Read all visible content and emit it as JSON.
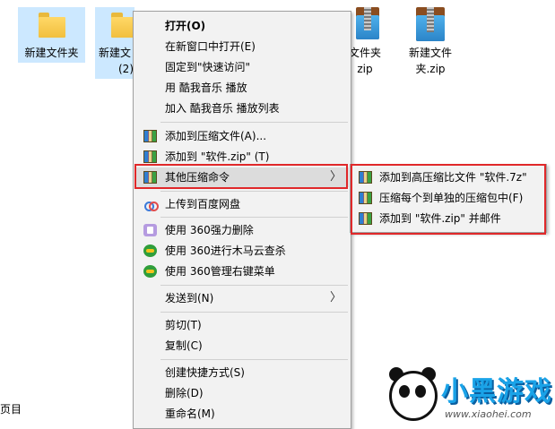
{
  "desktop": {
    "files": [
      {
        "label": "新建文件夹",
        "type": "folder"
      },
      {
        "label": "新建文",
        "label2": "(2)",
        "type": "folder"
      },
      {
        "label": "文件夹",
        "label2": "zip",
        "type": "zip"
      },
      {
        "label": "新建文件",
        "label2": "夹.zip",
        "type": "zip"
      }
    ],
    "edge_text": "页目"
  },
  "context_menu": {
    "items": [
      {
        "label": "打开(O)",
        "bold": true
      },
      {
        "label": "在新窗口中打开(E)"
      },
      {
        "label": "固定到\"快速访问\""
      },
      {
        "label": "用 酷我音乐 播放"
      },
      {
        "label": "加入 酷我音乐 播放列表"
      },
      {
        "label": "添加到压缩文件(A)...",
        "icon": "archive-icon"
      },
      {
        "label": "添加到 \"软件.zip\" (T)",
        "icon": "archive-icon"
      },
      {
        "label": "其他压缩命令",
        "icon": "archive-icon",
        "submenu": true,
        "highlighted": true
      },
      {
        "label": "上传到百度网盘",
        "icon": "baidu-cloud-icon"
      },
      {
        "label": "使用 360强力删除",
        "icon": "360-delete-icon"
      },
      {
        "label": "使用 360进行木马云查杀",
        "icon": "360-safe-icon"
      },
      {
        "label": "使用 360管理右键菜单",
        "icon": "360-safe-icon"
      },
      {
        "label": "发送到(N)",
        "submenu": true
      },
      {
        "label": "剪切(T)"
      },
      {
        "label": "复制(C)"
      },
      {
        "label": "创建快捷方式(S)"
      },
      {
        "label": "删除(D)"
      },
      {
        "label": "重命名(M)"
      }
    ]
  },
  "submenu": {
    "items": [
      {
        "label": "添加到高压缩比文件 \"软件.7z\"",
        "icon": "archive-icon"
      },
      {
        "label": "压缩每个到单独的压缩包中(F)",
        "icon": "archive-icon"
      },
      {
        "label": "添加到 \"软件.zip\" 并邮件",
        "icon": "archive-icon"
      }
    ]
  },
  "watermark": {
    "brand": "小黑游戏",
    "url": "www.xiaohei.com"
  },
  "colors": {
    "highlight_box": "#e0282a",
    "selection": "#cce8ff",
    "menu_bg": "#f2f2f2"
  }
}
